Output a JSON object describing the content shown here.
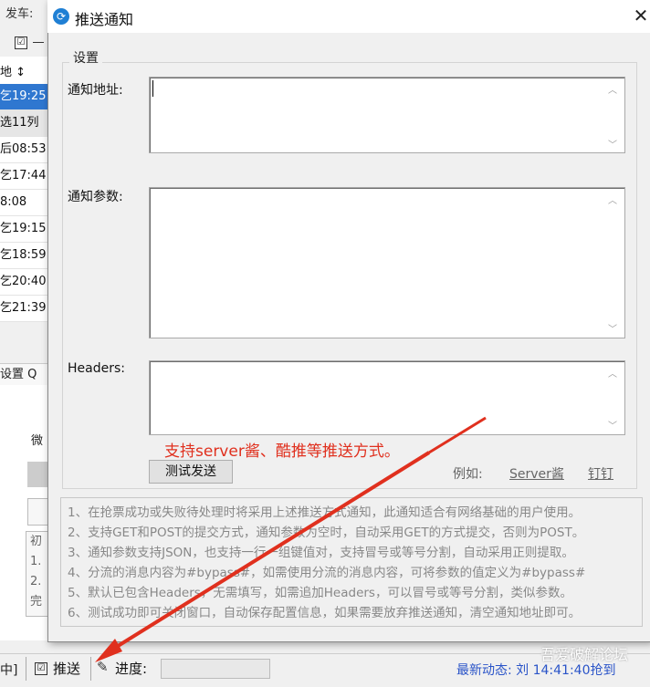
{
  "background_window": {
    "top_label": "发车:",
    "checkbox_mark": "☑",
    "list_header": "地 ↕",
    "rows": [
      "乞19:25",
      "选11列",
      "后08:53",
      "乞17:44",
      "8:08",
      "乞19:15",
      "乞18:59",
      "乞20:40",
      "乞21:39"
    ],
    "tab_label": "设置  Q",
    "side_label": "微",
    "notes_lines": [
      "初",
      "1.",
      "2.",
      "完"
    ]
  },
  "status_bar": {
    "left_text": "中]",
    "push_checkbox": "☑",
    "push_label": "推送",
    "progress_label": "进度:",
    "progress_value": 0,
    "latest_news": "最新动态: 刘    14:41:40抢到"
  },
  "watermark": "吾爱破解论坛",
  "dialog": {
    "title": "推送通知",
    "close_icon": "close-icon",
    "group_title": "设置",
    "fields": {
      "url_label": "通知地址:",
      "url_value": "",
      "params_label": "通知参数:",
      "params_value": "",
      "headers_label": "Headers:",
      "headers_value": ""
    },
    "annotation": "支持server酱、酷推等推送方式。",
    "test_button": "测试发送",
    "example_label": "例如:",
    "link_server": "Server酱",
    "link_dingding": "钉钉",
    "instructions": [
      "1、在抢票成功或失败待处理时将采用上述推送方式通知，此通知适合有网络基础的用户使用。",
      "2、支持GET和POST的提交方式，通知参数为空时，自动采用GET的方式提交，否则为POST。",
      "3、通知参数支持JSON，也支持一行一组键值对，支持冒号或等号分割，自动采用正则提取。",
      "4、分流的消息内容为#bypass#，如需使用分流的消息内容，可将参数的值定义为#bypass#",
      "5、默认已包含Headers，无需填写，如需追加Headers，可以冒号或等号分割，类似参数。",
      "6、测试成功即可关闭窗口，自动保存配置信息，如果需要放弃推送通知，清空通知地址即可。"
    ]
  },
  "colors": {
    "accent": "#2f77d0",
    "annotation": "#e0301e",
    "link": "#2a54c8"
  }
}
